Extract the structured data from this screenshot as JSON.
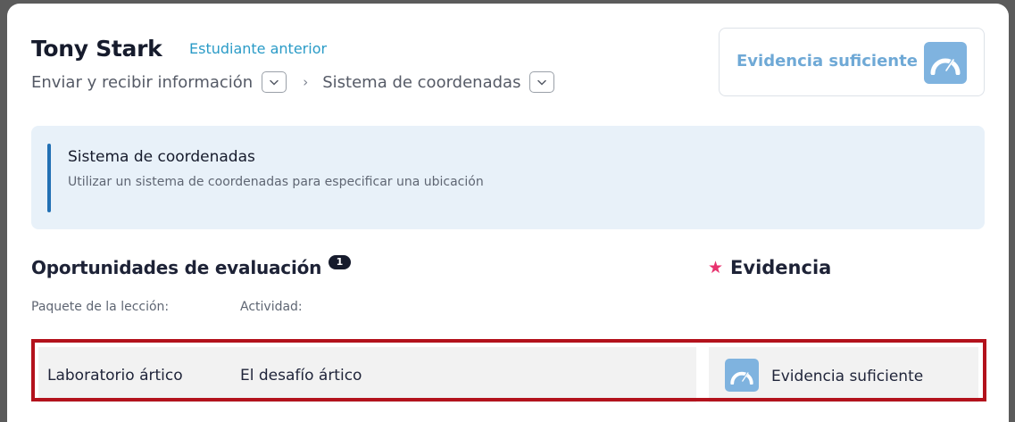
{
  "header": {
    "student_name": "Tony Stark",
    "previous_student_link": "Estudiante anterior",
    "breadcrumb": {
      "first": "Enviar y recibir información",
      "separator": "›",
      "second": "Sistema de coordenadas"
    },
    "evidence_status": {
      "label": "Evidencia suficiente",
      "icon": "gauge-icon",
      "color": "#6fa9d6"
    }
  },
  "standard": {
    "title": "Sistema de coordenadas",
    "description": "Utilizar un sistema de coordenadas para especificar una ubicación"
  },
  "assessment": {
    "title": "Oportunidades de evaluación",
    "count": "1",
    "evidence_heading": "Evidencia",
    "evidence_heading_icon": "star-icon",
    "columns": {
      "lesson_package": "Paquete de la lección:",
      "activity": "Actividad:"
    },
    "rows": [
      {
        "lesson_package": "Laboratorio ártico",
        "activity": "El desafío ártico",
        "evidence": "Evidencia suficiente"
      }
    ]
  },
  "colors": {
    "accent_link": "#2a9bc7",
    "info_bar": "#2270b4",
    "star": "#e8336f",
    "highlight_border": "#b3121c"
  }
}
